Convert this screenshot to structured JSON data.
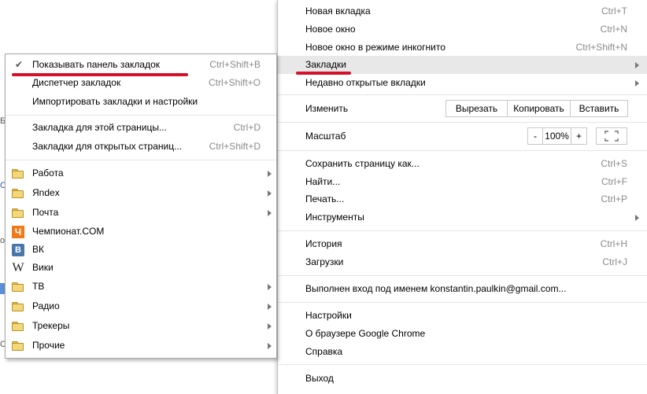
{
  "main_menu": {
    "items": [
      {
        "label": "Новая вкладка",
        "shortcut": "Ctrl+T"
      },
      {
        "label": "Новое окно",
        "shortcut": "Ctrl+N"
      },
      {
        "label": "Новое окно в режиме инкогнито",
        "shortcut": "Ctrl+Shift+N"
      },
      {
        "label": "Закладки",
        "shortcut": ""
      },
      {
        "label": "Недавно открытые вкладки",
        "shortcut": ""
      }
    ],
    "edit": {
      "label": "Изменить",
      "cut": "Вырезать",
      "copy": "Копировать",
      "paste": "Вставить"
    },
    "zoom": {
      "label": "Масштаб",
      "minus": "-",
      "value": "100%",
      "plus": "+"
    },
    "items2": [
      {
        "label": "Сохранить страницу как...",
        "shortcut": "Ctrl+S"
      },
      {
        "label": "Найти...",
        "shortcut": "Ctrl+F"
      },
      {
        "label": "Печать...",
        "shortcut": "Ctrl+P"
      },
      {
        "label": "Инструменты",
        "shortcut": ""
      }
    ],
    "items3": [
      {
        "label": "История",
        "shortcut": "Ctrl+H"
      },
      {
        "label": "Загрузки",
        "shortcut": "Ctrl+J"
      }
    ],
    "signed_in": "Выполнен вход под именем konstantin.paulkin@gmail.com...",
    "items4": [
      {
        "label": "Настройки"
      },
      {
        "label": "О браузере Google Chrome"
      },
      {
        "label": "Справка"
      }
    ],
    "exit": "Выход"
  },
  "bookmarks_menu": {
    "items": [
      {
        "label": "Показывать панель закладок",
        "shortcut": "Ctrl+Shift+B",
        "checked": true
      },
      {
        "label": "Диспетчер закладок",
        "shortcut": "Ctrl+Shift+O"
      },
      {
        "label": "Импортировать закладки и настройки",
        "shortcut": ""
      }
    ],
    "items2": [
      {
        "label": "Закладка для этой страницы...",
        "shortcut": "Ctrl+D"
      },
      {
        "label": "Закладки для открытых страниц...",
        "shortcut": "Ctrl+Shift+D"
      }
    ],
    "bookmarks": [
      {
        "label": "Работа",
        "icon": "folder-icon"
      },
      {
        "label": "Яndex",
        "icon": "folder-icon"
      },
      {
        "label": "Почта",
        "icon": "folder-icon"
      },
      {
        "label": "Чемпионат.COM",
        "icon": "championat-icon"
      },
      {
        "label": "ВК",
        "icon": "vk-icon"
      },
      {
        "label": "Вики",
        "icon": "wikipedia-icon"
      },
      {
        "label": "ТВ",
        "icon": "folder-icon"
      },
      {
        "label": "Радио",
        "icon": "folder-icon"
      },
      {
        "label": "Трекеры",
        "icon": "folder-icon"
      },
      {
        "label": "Прочие",
        "icon": "folder-icon"
      }
    ],
    "check_glyph": "✔",
    "championat_glyph": "Ч",
    "vk_glyph": "B",
    "wiki_glyph": "W"
  },
  "colors": {
    "highlight": "#e8e8e8",
    "annotation": "#d5102a"
  }
}
